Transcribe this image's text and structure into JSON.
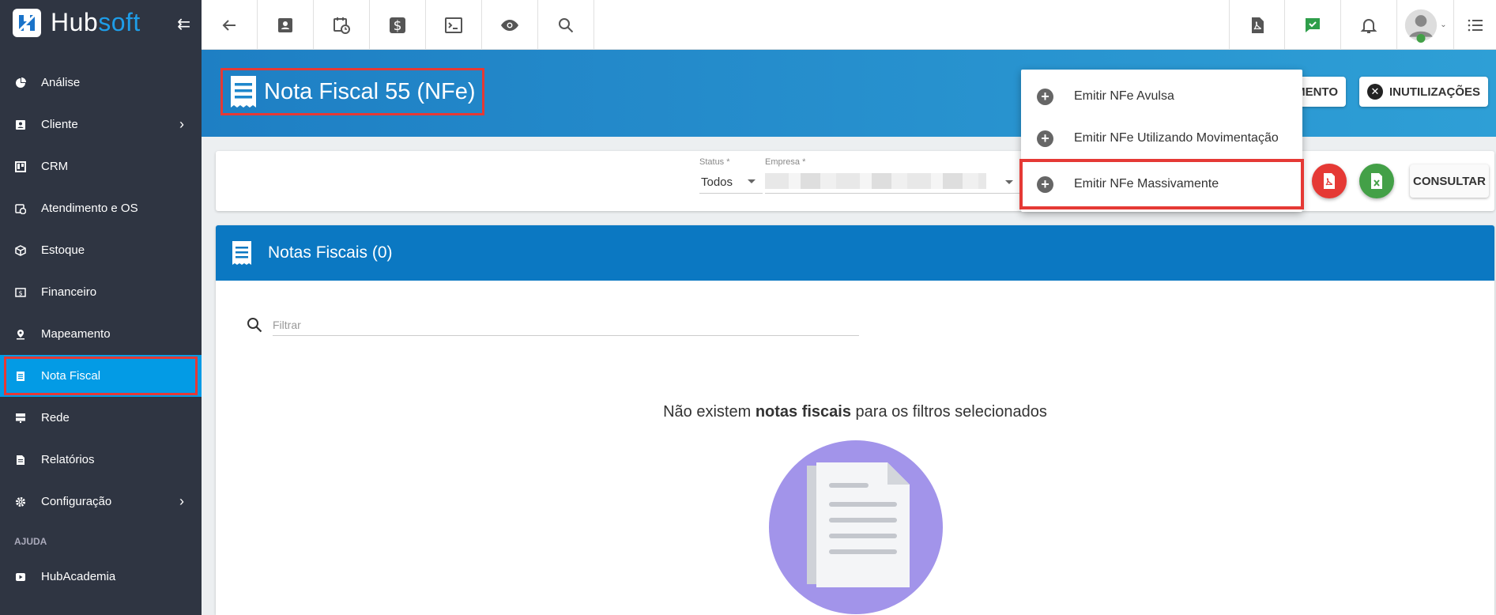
{
  "app": {
    "brand_hub": "Hub",
    "brand_soft": "soft"
  },
  "sidebar": {
    "items": [
      {
        "label": "Análise",
        "icon": "pie-chart-icon"
      },
      {
        "label": "Cliente",
        "icon": "contact-card-icon",
        "has_submenu": true
      },
      {
        "label": "CRM",
        "icon": "kanban-icon"
      },
      {
        "label": "Atendimento e OS",
        "icon": "calendar-clock-icon"
      },
      {
        "label": "Estoque",
        "icon": "box-icon"
      },
      {
        "label": "Financeiro",
        "icon": "money-icon"
      },
      {
        "label": "Mapeamento",
        "icon": "map-pin-icon"
      },
      {
        "label": "Nota Fiscal",
        "icon": "receipt-icon",
        "active": true
      },
      {
        "label": "Rede",
        "icon": "server-icon"
      },
      {
        "label": "Relatórios",
        "icon": "document-icon"
      },
      {
        "label": "Configuração",
        "icon": "gear-icon",
        "has_submenu": true
      }
    ],
    "section_help": "AJUDA",
    "help_items": [
      {
        "label": "HubAcademia",
        "icon": "play-icon"
      }
    ]
  },
  "header": {
    "title": "Nota Fiscal 55 (NFe)",
    "btn_movimento": "MENTO",
    "btn_inutilizacoes": "INUTILIZAÇÕES"
  },
  "dropdown": {
    "items": [
      {
        "label": "Emitir NFe Avulsa"
      },
      {
        "label": "Emitir NFe Utilizando Movimentação"
      },
      {
        "label": "Emitir NFe Massivamente"
      }
    ]
  },
  "filters": {
    "status_label": "Status *",
    "status_value": "Todos",
    "empresa_label": "Empresa *",
    "consultar": "CONSULTAR"
  },
  "list": {
    "title": "Notas Fiscais (0)",
    "filter_placeholder": "Filtrar",
    "empty_pre": "Não existem ",
    "empty_bold": "notas fiscais",
    "empty_post": " para os filtros selecionados"
  },
  "colors": {
    "sidebar_bg": "#2f3542",
    "active_blue": "#039be5",
    "highlight_red": "#e53935",
    "header_blue": "#0b78c2",
    "pdf_red": "#e53935",
    "excel_green": "#43a047",
    "illustration_purple": "#a294ea"
  }
}
